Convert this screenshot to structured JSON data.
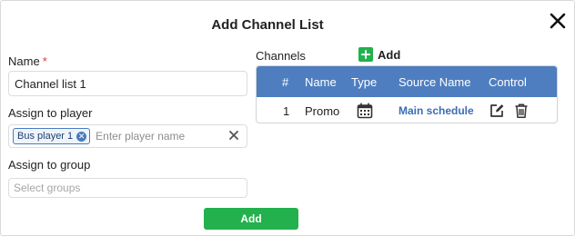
{
  "dialog": {
    "title": "Add Channel List"
  },
  "form": {
    "name_label": "Name",
    "name_required_mark": "*",
    "name_value": "Channel list 1",
    "player_label": "Assign to player",
    "player_tags": [
      "Bus player 1"
    ],
    "player_placeholder": "Enter player name",
    "group_label": "Assign to group",
    "group_placeholder": "Select groups",
    "submit_label": "Add"
  },
  "channels": {
    "label": "Channels",
    "add_label": "Add",
    "columns": [
      "#",
      "Name",
      "Type",
      "Source Name",
      "Control"
    ],
    "rows": [
      {
        "num": "1",
        "name": "Promo",
        "type_icon": "calendar-icon",
        "source": "Main schedule"
      }
    ]
  },
  "colors": {
    "header_blue": "#4f7ec0",
    "add_green": "#22b14c",
    "link_blue": "#3b6cb6",
    "required_red": "#e53935"
  }
}
